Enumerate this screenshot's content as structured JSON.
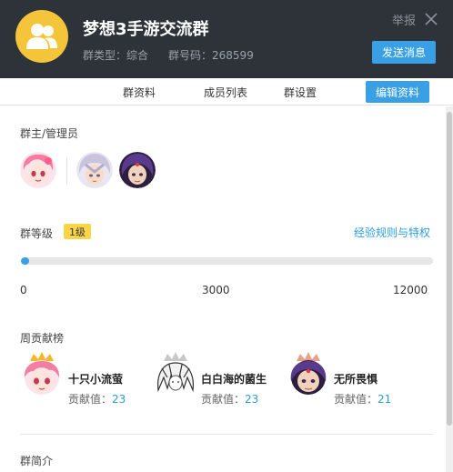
{
  "header": {
    "title": "梦想3手游交流群",
    "group_type_label": "群类型：",
    "group_type_value": "综合",
    "group_number_label": "群号码：",
    "group_number_value": "268599",
    "report_label": "举报",
    "send_button": "发送消息"
  },
  "tabs": [
    {
      "label": "群资料"
    },
    {
      "label": "成员列表"
    },
    {
      "label": "群设置"
    }
  ],
  "edit_button": "编辑资料",
  "owners": {
    "label": "群主/管理员"
  },
  "level": {
    "label": "群等级",
    "badge": "1级",
    "rules_link": "经验规则与特权",
    "progress_fraction": 0.02,
    "ticks": [
      "0",
      "3000",
      "12000"
    ]
  },
  "weekly": {
    "label": "周贡献榜",
    "score_label": "贡献值：",
    "contributors": [
      {
        "name": "十只小流萤",
        "score": "23"
      },
      {
        "name": "白白海的菌生",
        "score": "23"
      },
      {
        "name": "无所畏惧",
        "score": "21"
      }
    ]
  },
  "intro": {
    "label": "群简介"
  },
  "colors": {
    "header_bg": "#2d3338",
    "accent": "#3aa0e5",
    "link": "#2b9ddc",
    "badge": "#f9d54a",
    "group_avatar": "#f4c53a"
  }
}
